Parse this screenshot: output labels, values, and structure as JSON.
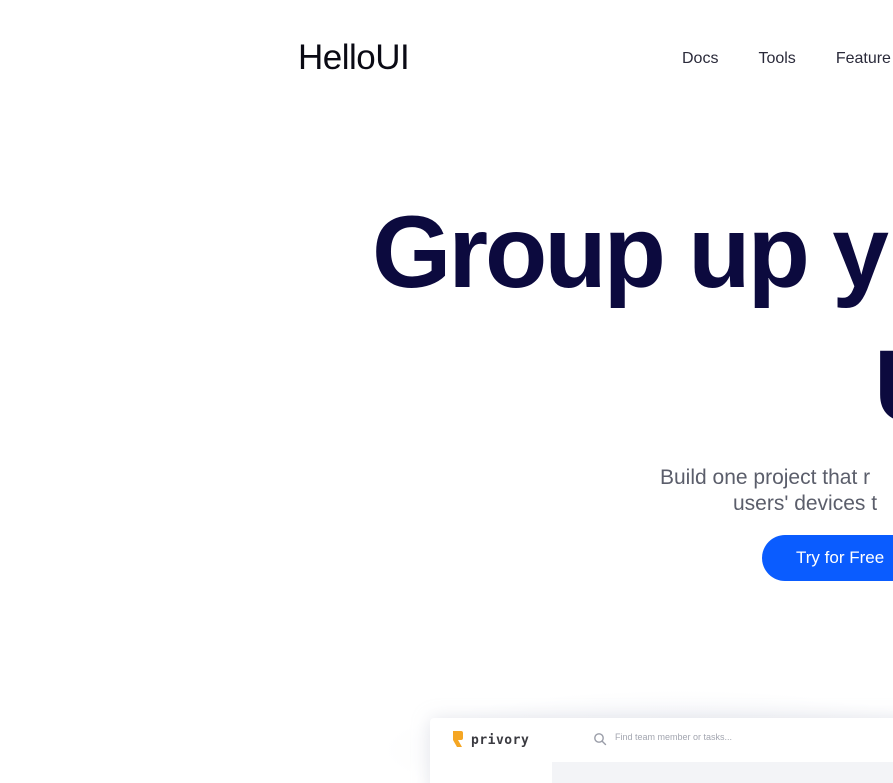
{
  "header": {
    "logo": "HelloUI",
    "nav": [
      {
        "label": "Docs"
      },
      {
        "label": "Tools"
      },
      {
        "label": "Feature"
      }
    ]
  },
  "hero": {
    "headline_line1": "Group up y",
    "headline_line2": "U",
    "subtitle_line1": "Build one project that r",
    "subtitle_line2": "users' devices t",
    "cta_label": "Try for Free"
  },
  "preview": {
    "brand": "privory",
    "search_placeholder": "Find team member or tasks...",
    "icons": [
      "brand-logo-icon",
      "search-icon"
    ]
  },
  "colors": {
    "accent": "#0a5cff",
    "headline": "#0c0a3e",
    "brand_icon": "#f5a623"
  }
}
